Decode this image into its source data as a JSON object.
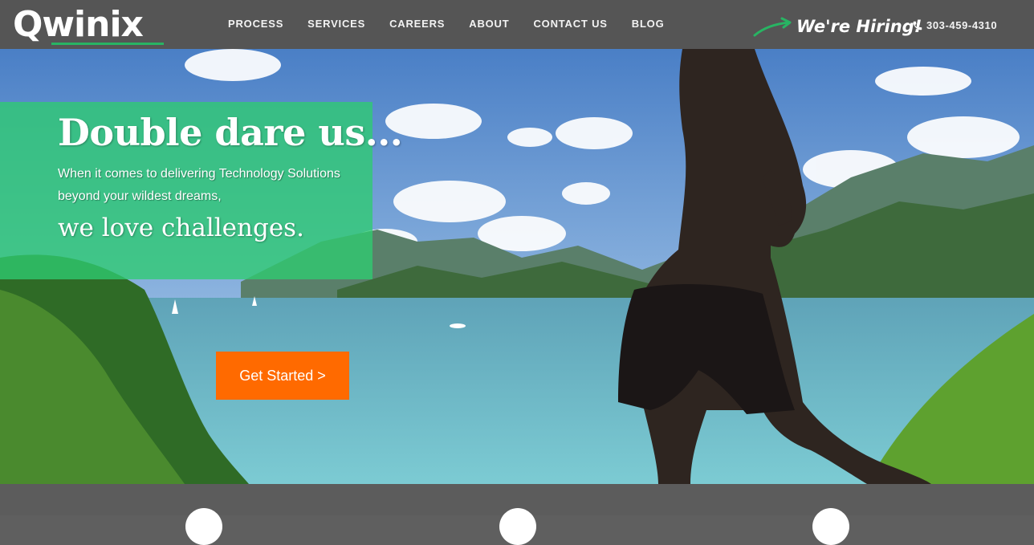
{
  "brand": {
    "logo_text": "Qwinix",
    "accent_color": "#28b463"
  },
  "nav": {
    "items": [
      {
        "label": "PROCESS"
      },
      {
        "label": "SERVICES"
      },
      {
        "label": "CAREERS"
      },
      {
        "label": "ABOUT"
      },
      {
        "label": "CONTACT US"
      },
      {
        "label": "BLOG"
      }
    ]
  },
  "header": {
    "hiring_text": "We're Hiring!",
    "phone": "303-459-4310"
  },
  "hero": {
    "title": "Double dare us...",
    "subtitle": "When it comes to delivering Technology Solutions beyond your wildest dreams,",
    "tagline": "we love challenges.",
    "cta_label": "Get Started >",
    "cta_color": "#ff6a00",
    "overlay_color": "#2ecc71"
  },
  "features": {
    "icons": [
      "feature-circle-icon",
      "feature-rocket-icon",
      "feature-circle-icon"
    ]
  }
}
